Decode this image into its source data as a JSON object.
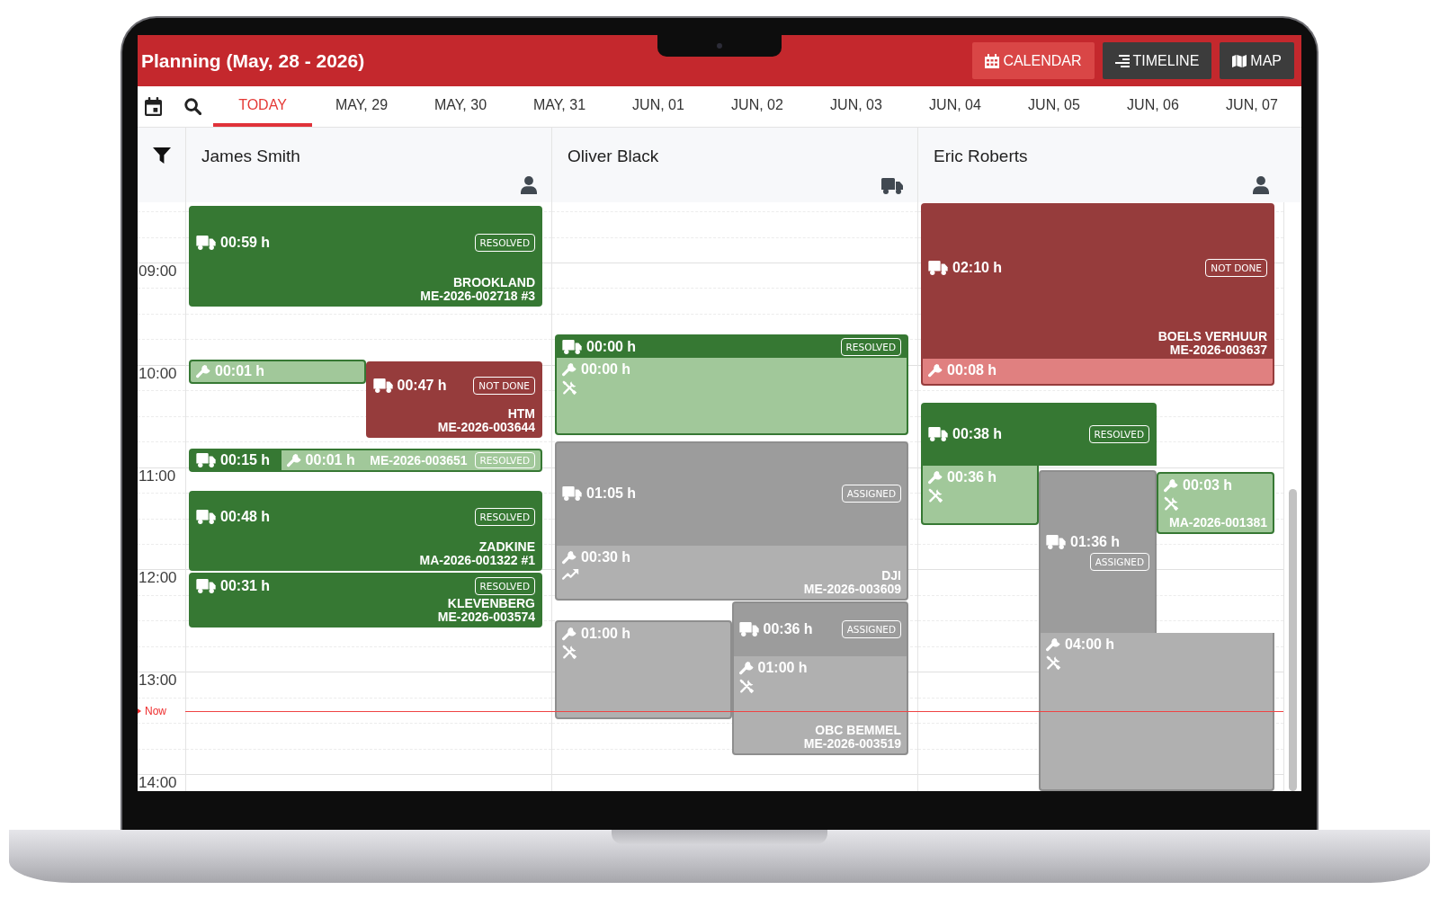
{
  "header": {
    "title": "Planning (May, 28 - 2026)",
    "views": [
      {
        "label": "CALENDAR",
        "kind": "calendar",
        "selected": true
      },
      {
        "label": "TIMELINE",
        "kind": "timeline",
        "selected": false
      },
      {
        "label": "MAP",
        "kind": "map",
        "selected": false
      }
    ]
  },
  "date_tabs": [
    {
      "label": "TODAY",
      "selected": true
    },
    {
      "label": "MAY, 29",
      "selected": false
    },
    {
      "label": "MAY, 30",
      "selected": false
    },
    {
      "label": "MAY, 31",
      "selected": false
    },
    {
      "label": "JUN, 01",
      "selected": false
    },
    {
      "label": "JUN, 02",
      "selected": false
    },
    {
      "label": "JUN, 03",
      "selected": false
    },
    {
      "label": "JUN, 04",
      "selected": false
    },
    {
      "label": "JUN, 05",
      "selected": false
    },
    {
      "label": "JUN, 06",
      "selected": false
    },
    {
      "label": "JUN, 07",
      "selected": false
    }
  ],
  "time_axis": {
    "hours": [
      "09:00",
      "10:00",
      "11:00",
      "12:00",
      "13:00",
      "14:00"
    ],
    "now": {
      "label": "Now"
    }
  },
  "resources": [
    {
      "name": "James Smith",
      "kind": "person",
      "events": [
        {
          "color": "#367833",
          "badge": "RESOLVED",
          "location": "BROOKLAND",
          "reference": "ME-2026-002718 #3",
          "segments": [
            {
              "kind": "travel",
              "color": "#367833",
              "duration": "00:59 h"
            }
          ]
        },
        {
          "color": "#367833",
          "segments": [
            {
              "kind": "work",
              "color": "#a1c89a",
              "duration": "00:01 h"
            }
          ]
        },
        {
          "color": "#963c3c",
          "badge": "NOT DONE",
          "location": "HTM",
          "reference": "ME-2026-003644",
          "segments": [
            {
              "kind": "travel",
              "color": "#963c3c",
              "duration": "00:47 h"
            }
          ]
        },
        {
          "color": "#367833",
          "badge": "RESOLVED",
          "reference": "ME-2026-003651",
          "segments": [
            {
              "kind": "travel",
              "color": "#367833",
              "duration": "00:15 h"
            },
            {
              "kind": "work",
              "color": "#a1c89a",
              "duration": "00:01 h"
            }
          ]
        },
        {
          "color": "#367833",
          "badge": "RESOLVED",
          "location": "ZADKINE",
          "reference": "MA-2026-001322 #1",
          "segments": [
            {
              "kind": "travel",
              "color": "#367833",
              "duration": "00:48 h"
            }
          ]
        },
        {
          "color": "#367833",
          "badge": "RESOLVED",
          "location": "KLEVENBERG",
          "reference": "ME-2026-003574",
          "segments": [
            {
              "kind": "travel",
              "color": "#367833",
              "duration": "00:31 h"
            }
          ]
        }
      ]
    },
    {
      "name": "Oliver Black",
      "kind": "vehicle",
      "events": [
        {
          "color": "#367833",
          "badge": "RESOLVED",
          "segments": [
            {
              "kind": "travel",
              "color": "#367833",
              "duration": "00:00 h"
            },
            {
              "kind": "repair",
              "color": "#a1c89a",
              "duration": "00:00 h"
            }
          ]
        },
        {
          "color": "#8e8e8e",
          "badge": "ASSIGNED",
          "location": "DJI",
          "reference": "ME-2026-003609",
          "segments": [
            {
              "kind": "travel",
              "color": "#9c9c9c",
              "duration": "01:05 h"
            },
            {
              "kind": "upgrade",
              "color": "#b0b0b0",
              "duration": "00:30 h"
            }
          ]
        },
        {
          "color": "#8e8e8e",
          "segments": [
            {
              "kind": "repair",
              "color": "#b0b0b0",
              "duration": "01:00 h"
            }
          ]
        },
        {
          "color": "#8e8e8e",
          "badge": "ASSIGNED",
          "location": "OBC BEMMEL",
          "reference": "ME-2026-003519",
          "segments": [
            {
              "kind": "travel",
              "color": "#9c9c9c",
              "duration": "00:36 h"
            },
            {
              "kind": "repair",
              "color": "#b0b0b0",
              "duration": "01:00 h"
            }
          ]
        }
      ]
    },
    {
      "name": "Eric Roberts",
      "kind": "person",
      "events": [
        {
          "color": "#963c3c",
          "badge": "NOT DONE",
          "location": "BOELS VERHUUR",
          "reference": "ME-2026-003637",
          "segments": [
            {
              "kind": "travel",
              "color": "#963c3c",
              "duration": "02:10 h"
            },
            {
              "kind": "work",
              "color": "#e08080",
              "duration": "00:08 h"
            }
          ]
        },
        {
          "color": "#367833",
          "badge": "RESOLVED",
          "segments": [
            {
              "kind": "travel",
              "color": "#367833",
              "duration": "00:38 h"
            },
            {
              "kind": "repair",
              "color": "#a1c89a",
              "duration": "00:36 h"
            }
          ]
        },
        {
          "color": "#8e8e8e",
          "badge": "ASSIGNED",
          "segments": [
            {
              "kind": "travel",
              "color": "#9c9c9c",
              "duration": "01:36 h"
            },
            {
              "kind": "repair",
              "color": "#b0b0b0",
              "duration": "04:00 h"
            }
          ]
        },
        {
          "color": "#367833",
          "reference": "MA-2026-001381",
          "segments": [
            {
              "kind": "repair",
              "color": "#a1c89a",
              "duration": "00:03 h"
            }
          ]
        }
      ]
    }
  ]
}
